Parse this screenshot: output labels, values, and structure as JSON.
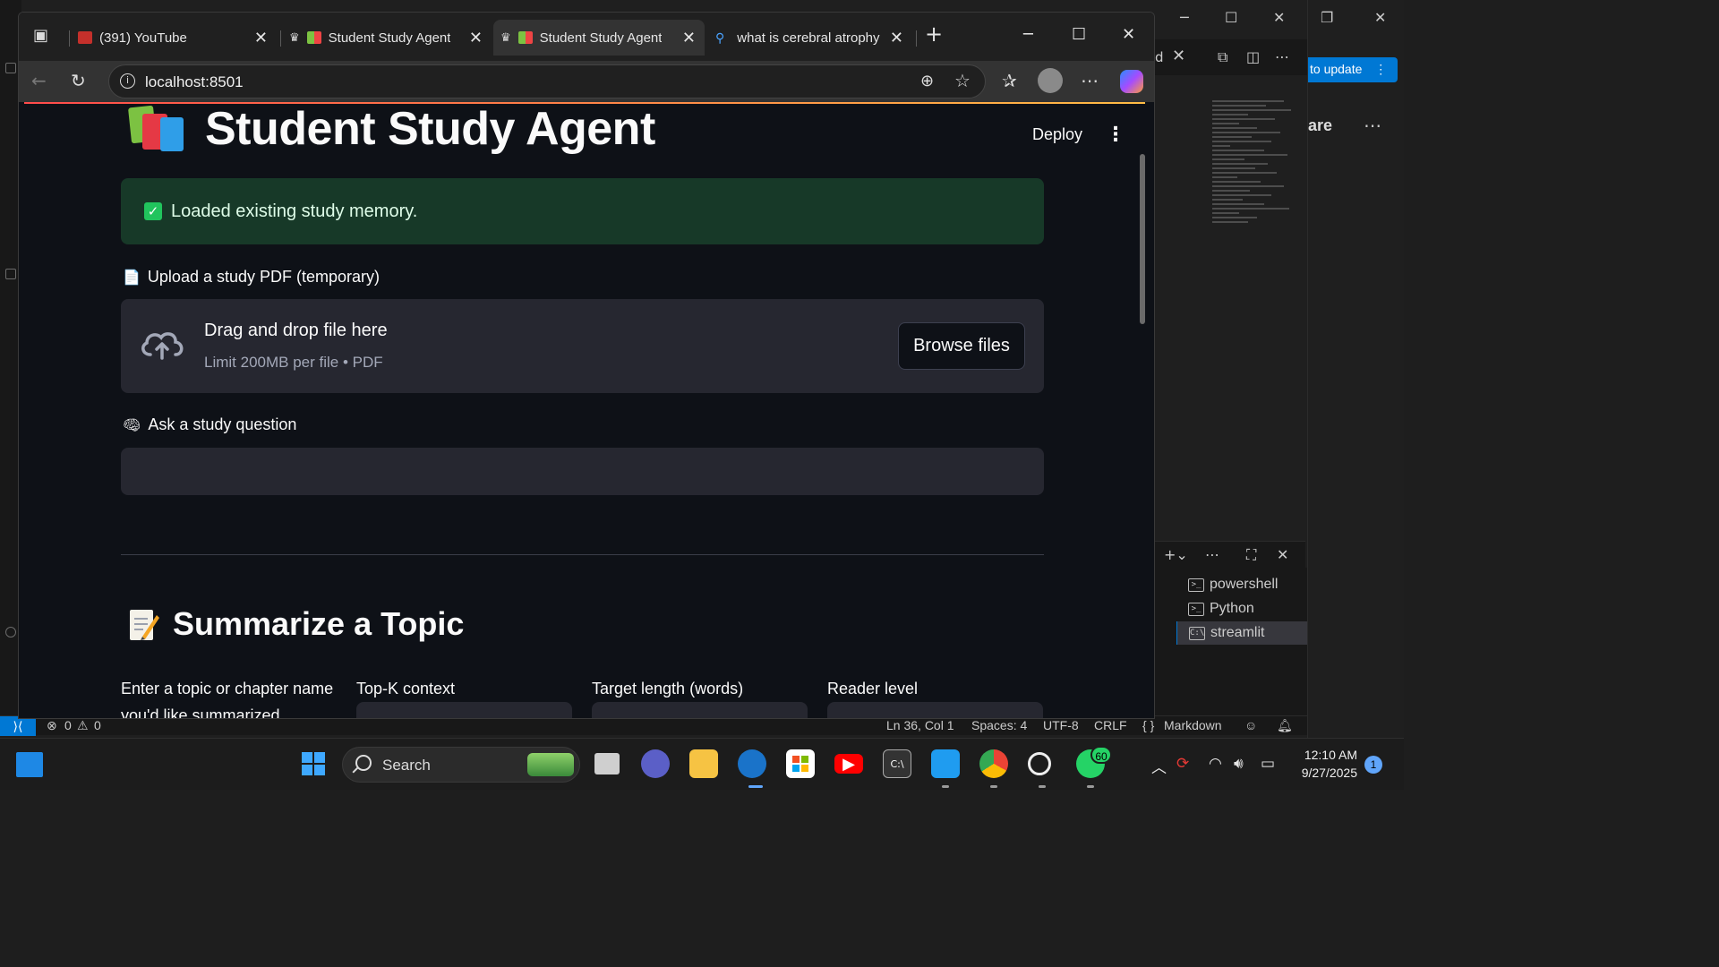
{
  "browser": {
    "tabs": [
      {
        "label": "(391) YouTube",
        "active": false
      },
      {
        "label": "Student Study Agent",
        "active": false
      },
      {
        "label": "Student Study Agent",
        "active": true
      },
      {
        "label": "what is cerebral atrophy",
        "active": false
      }
    ],
    "url": "localhost:8501"
  },
  "app": {
    "title": "Student Study Agent",
    "deploy_label": "Deploy",
    "success_message": "Loaded existing study memory.",
    "upload_label": "Upload a study PDF (temporary)",
    "dropzone_title": "Drag and drop file here",
    "dropzone_limit": "Limit 200MB per file • PDF",
    "browse_label": "Browse files",
    "question_label": "Ask a study question",
    "question_value": "",
    "summarize_title": "Summarize a Topic",
    "columns": [
      "Enter a topic or chapter name you'd like summarized",
      "Top-K context",
      "Target length (words)",
      "Reader level"
    ]
  },
  "vscode": {
    "update_label": "to update",
    "partial_heading": "are",
    "terminals": [
      "powershell",
      "Python",
      "streamlit"
    ],
    "status": {
      "errors": "0",
      "warnings": "0",
      "position": "Ln 36, Col 1",
      "spaces": "Spaces: 4",
      "encoding": "UTF-8",
      "eol": "CRLF",
      "language": "Markdown"
    }
  },
  "taskbar": {
    "search_label": "Search",
    "whatsapp_badge": "60",
    "time": "12:10 AM",
    "date": "9/27/2025",
    "notifications": "1"
  },
  "colors": {
    "accent_blue": "#0078d4",
    "success_bg": "#173928",
    "success_check": "#21c45d",
    "streamlit_bg": "#0e1117",
    "widget_bg": "#262730"
  }
}
